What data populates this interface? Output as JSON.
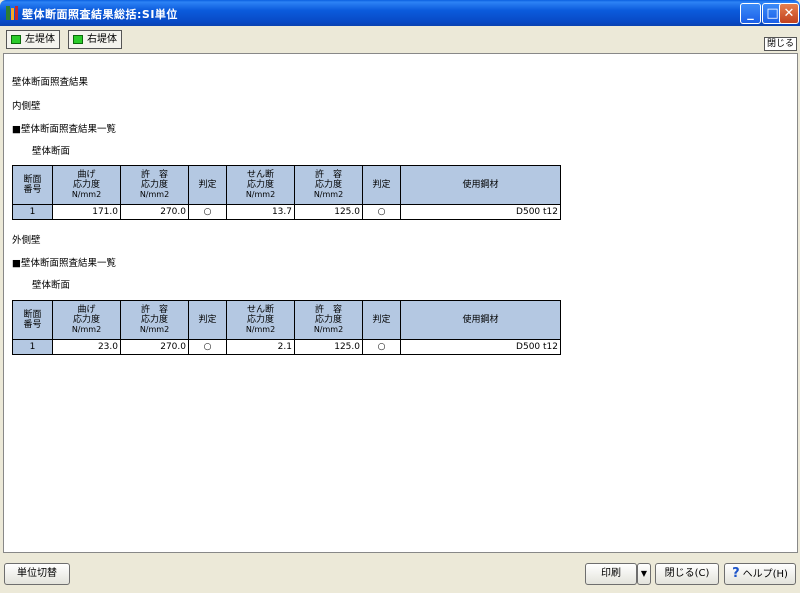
{
  "window": {
    "title": "壁体断面照査結果総括:SI単位",
    "minimize_glyph": "_",
    "maximize_glyph": "□",
    "close_glyph": "✕"
  },
  "toolbar": {
    "left_body": "左堤体",
    "right_body": "右堤体",
    "close": "閉じる"
  },
  "report": {
    "heading": "壁体断面照査結果",
    "sections": [
      {
        "side": "内側壁",
        "list_title": "■壁体断面照査結果一覧",
        "sub_title": "壁体断面",
        "headers": {
          "section_no": [
            "断面",
            "番号"
          ],
          "bending_stress": [
            "曲げ",
            "応力度",
            "N/mm2"
          ],
          "allow_1": [
            "許　容",
            "応力度",
            "N/mm2"
          ],
          "judge_1": "判定",
          "shear_stress": [
            "せん断",
            "応力度",
            "N/mm2"
          ],
          "allow_2": [
            "許　容",
            "応力度",
            "N/mm2"
          ],
          "judge_2": "判定",
          "steel": "使用鋼材"
        },
        "row": {
          "no": "1",
          "bending": "171.0",
          "allow_1": "270.0",
          "judge_1": "○",
          "shear": "13.7",
          "allow_2": "125.0",
          "judge_2": "○",
          "steel": "D500 t12"
        }
      },
      {
        "side": "外側壁",
        "list_title": "■壁体断面照査結果一覧",
        "sub_title": "壁体断面",
        "headers": {
          "section_no": [
            "断面",
            "番号"
          ],
          "bending_stress": [
            "曲げ",
            "応力度",
            "N/mm2"
          ],
          "allow_1": [
            "許　容",
            "応力度",
            "N/mm2"
          ],
          "judge_1": "判定",
          "shear_stress": [
            "せん断",
            "応力度",
            "N/mm2"
          ],
          "allow_2": [
            "許　容",
            "応力度",
            "N/mm2"
          ],
          "judge_2": "判定",
          "steel": "使用鋼材"
        },
        "row": {
          "no": "1",
          "bending": "23.0",
          "allow_1": "270.0",
          "judge_1": "○",
          "shear": "2.1",
          "allow_2": "125.0",
          "judge_2": "○",
          "steel": "D500 t12"
        }
      }
    ]
  },
  "footer": {
    "unit_switch": "単位切替",
    "print": "印刷",
    "print_dropdown_glyph": "▼",
    "close": "閉じる(C)",
    "help": "ヘルプ(H)",
    "help_glyph": "?"
  },
  "colors": {
    "title_bar": "#0B5BDC",
    "table_header": "#B4C8E2",
    "toggle_green": "#2BCB2B"
  }
}
